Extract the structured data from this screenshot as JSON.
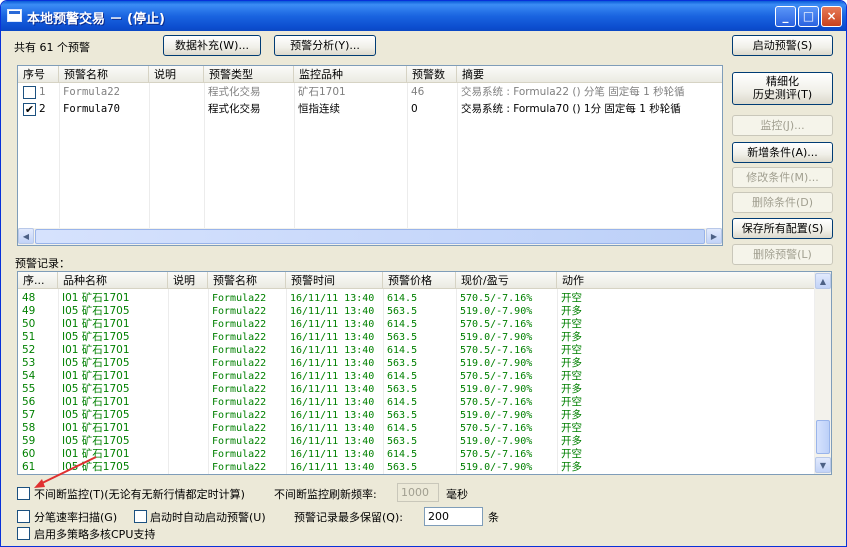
{
  "window": {
    "title": "本地预警交易 － (停止)"
  },
  "titlebar": {
    "minimize": "_",
    "maximize": "□",
    "close": "×"
  },
  "top": {
    "count_text": "共有 61 个预警",
    "btn_data_fill": "数据补充(W)...",
    "btn_analysis": "预警分析(Y)...",
    "btn_start": "启动预警(S)"
  },
  "alerts_table": {
    "columns": [
      "序号",
      "预警名称",
      "说明",
      "预警类型",
      "监控品种",
      "预警数",
      "摘要"
    ],
    "rows": [
      {
        "checked": false,
        "index": "1",
        "name": "Formula22",
        "desc": "",
        "type": "程式化交易",
        "symbol": "矿石1701",
        "count": "46",
        "summary": "交易系统 : Formula22 () 分笔 固定每 1 秒轮循"
      },
      {
        "checked": true,
        "index": "2",
        "name": "Formula70",
        "desc": "",
        "type": "程式化交易",
        "symbol": "恒指连续",
        "count": "0",
        "summary": "交易系统 : Formula70 () 1分 固定每 1 秒轮循"
      }
    ]
  },
  "side_buttons": {
    "refine": "精细化",
    "history": "历史测评(T)",
    "monitor": "监控(J)...",
    "add_cond": "新增条件(A)...",
    "edit_cond": "修改条件(M)...",
    "del_cond": "删除条件(D)",
    "save_all": "保存所有配置(S)",
    "del_alert": "删除预警(L)"
  },
  "records": {
    "label": "预警记录：",
    "columns": [
      "序...",
      "品种名称",
      "说明",
      "预警名称",
      "预警时间",
      "预警价格",
      "现价/盈亏",
      "动作"
    ],
    "rows": [
      {
        "no": "48",
        "symbol": "I01 矿石1701",
        "desc": "",
        "alert": "Formula22",
        "time": "16/11/11 13:40",
        "price": "614.5",
        "pnl": "570.5/-7.16%",
        "action": "开空"
      },
      {
        "no": "49",
        "symbol": "I05 矿石1705",
        "desc": "",
        "alert": "Formula22",
        "time": "16/11/11 13:40",
        "price": "563.5",
        "pnl": "519.0/-7.90%",
        "action": "开多"
      },
      {
        "no": "50",
        "symbol": "I01 矿石1701",
        "desc": "",
        "alert": "Formula22",
        "time": "16/11/11 13:40",
        "price": "614.5",
        "pnl": "570.5/-7.16%",
        "action": "开空"
      },
      {
        "no": "51",
        "symbol": "I05 矿石1705",
        "desc": "",
        "alert": "Formula22",
        "time": "16/11/11 13:40",
        "price": "563.5",
        "pnl": "519.0/-7.90%",
        "action": "开多"
      },
      {
        "no": "52",
        "symbol": "I01 矿石1701",
        "desc": "",
        "alert": "Formula22",
        "time": "16/11/11 13:40",
        "price": "614.5",
        "pnl": "570.5/-7.16%",
        "action": "开空"
      },
      {
        "no": "53",
        "symbol": "I05 矿石1705",
        "desc": "",
        "alert": "Formula22",
        "time": "16/11/11 13:40",
        "price": "563.5",
        "pnl": "519.0/-7.90%",
        "action": "开多"
      },
      {
        "no": "54",
        "symbol": "I01 矿石1701",
        "desc": "",
        "alert": "Formula22",
        "time": "16/11/11 13:40",
        "price": "614.5",
        "pnl": "570.5/-7.16%",
        "action": "开空"
      },
      {
        "no": "55",
        "symbol": "I05 矿石1705",
        "desc": "",
        "alert": "Formula22",
        "time": "16/11/11 13:40",
        "price": "563.5",
        "pnl": "519.0/-7.90%",
        "action": "开多"
      },
      {
        "no": "56",
        "symbol": "I01 矿石1701",
        "desc": "",
        "alert": "Formula22",
        "time": "16/11/11 13:40",
        "price": "614.5",
        "pnl": "570.5/-7.16%",
        "action": "开空"
      },
      {
        "no": "57",
        "symbol": "I05 矿石1705",
        "desc": "",
        "alert": "Formula22",
        "time": "16/11/11 13:40",
        "price": "563.5",
        "pnl": "519.0/-7.90%",
        "action": "开多"
      },
      {
        "no": "58",
        "symbol": "I01 矿石1701",
        "desc": "",
        "alert": "Formula22",
        "time": "16/11/11 13:40",
        "price": "614.5",
        "pnl": "570.5/-7.16%",
        "action": "开空"
      },
      {
        "no": "59",
        "symbol": "I05 矿石1705",
        "desc": "",
        "alert": "Formula22",
        "time": "16/11/11 13:40",
        "price": "563.5",
        "pnl": "519.0/-7.90%",
        "action": "开多"
      },
      {
        "no": "60",
        "symbol": "I01 矿石1701",
        "desc": "",
        "alert": "Formula22",
        "time": "16/11/11 13:40",
        "price": "614.5",
        "pnl": "570.5/-7.16%",
        "action": "开空"
      },
      {
        "no": "61",
        "symbol": "I05 矿石1705",
        "desc": "",
        "alert": "Formula22",
        "time": "16/11/11 13:40",
        "price": "563.5",
        "pnl": "519.0/-7.90%",
        "action": "开多"
      }
    ]
  },
  "options": {
    "continuous_monitor": "不间断监控(T)(无论有无新行情都定时计算)",
    "refresh_label": "不间断监控刷新频率:",
    "refresh_value": "1000",
    "refresh_unit": "毫秒",
    "tick_scan": "分笔速率扫描(G)",
    "auto_start": "启动时自动启动预警(U)",
    "max_records_label": "预警记录最多保留(Q):",
    "max_records_value": "200",
    "max_records_unit": "条",
    "multi_cpu": "启用多策略多核CPU支持"
  },
  "colors": {
    "title_bar": "#0a5bd8",
    "record_text": "#008000",
    "annotation_arrow": "#e03030"
  }
}
